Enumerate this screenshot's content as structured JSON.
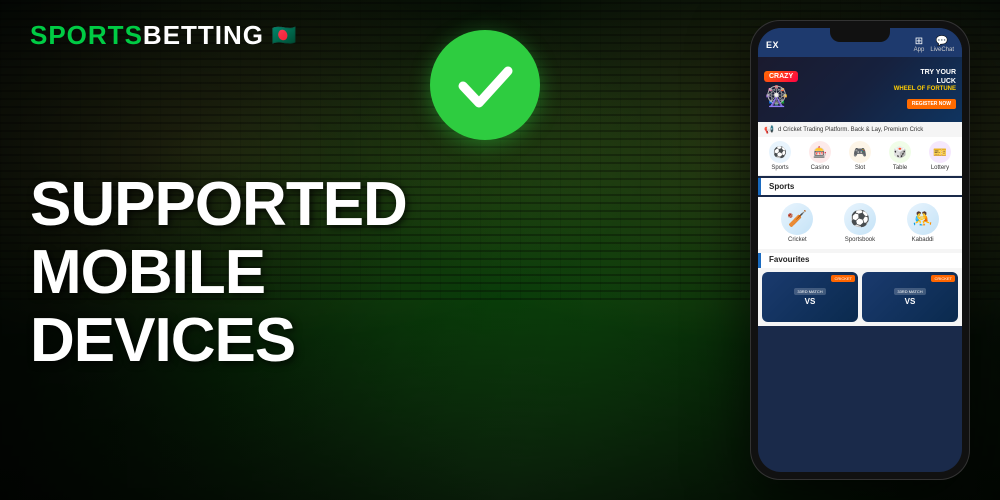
{
  "logo": {
    "sports": "SPORTS",
    "betting": "BETTING",
    "flag": "🇧🇩"
  },
  "heading": {
    "line1": "Supported",
    "line2": "Mobile Devices"
  },
  "app": {
    "header": {
      "logo": "EX",
      "app_label": "App",
      "livechat_label": "LiveChat"
    },
    "banner": {
      "crazy": "CRAZY",
      "try_your_luck": "TRY YOUR\nLUCK",
      "wheel": "WHEEL OF FORTUNE",
      "register": "REGISTER NOW"
    },
    "ticker": "d Cricket Trading Platform. Back & Lay, Premium Crick",
    "nav": {
      "tabs": [
        {
          "label": "Sports",
          "icon": "⚽",
          "style": "sports"
        },
        {
          "label": "Casino",
          "icon": "🎰",
          "style": "casino"
        },
        {
          "label": "Slot",
          "icon": "🎮",
          "style": "slot"
        },
        {
          "label": "Table",
          "icon": "🎲",
          "style": "table"
        },
        {
          "label": "Lottery",
          "icon": "🎫",
          "style": "lottery"
        }
      ]
    },
    "sports_section": {
      "title": "Sports",
      "items": [
        {
          "label": "Cricket",
          "icon": "🏏"
        },
        {
          "label": "Sportsbook",
          "icon": "⚽"
        },
        {
          "label": "Kabaddi",
          "icon": "🤼"
        }
      ]
    },
    "favourites": {
      "title": "Favourites",
      "cards": [
        {
          "match": "33RD MATCH",
          "sport": "CRICKET",
          "vs": "VS"
        },
        {
          "match": "33RD MATCH",
          "sport": "CRICKET",
          "vs": "VS"
        }
      ]
    }
  }
}
